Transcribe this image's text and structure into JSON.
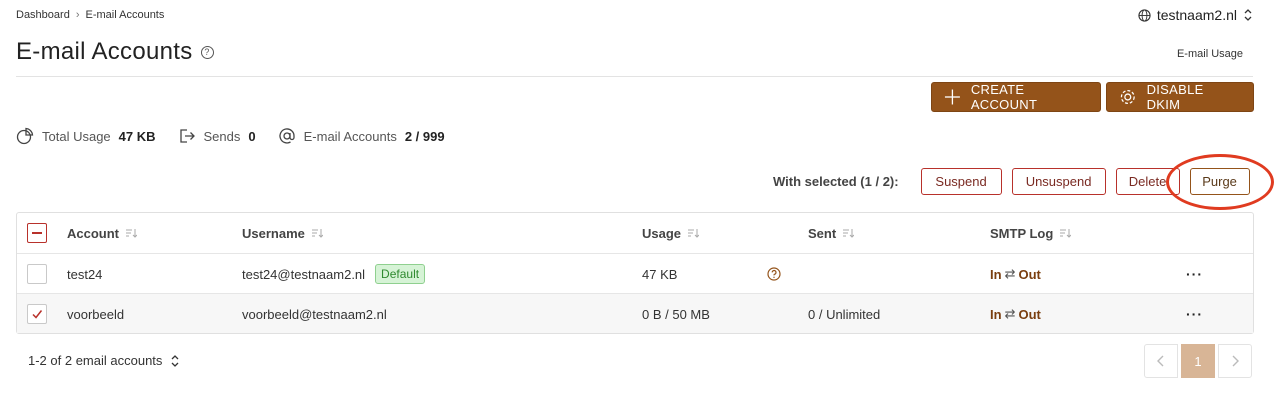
{
  "breadcrumb": {
    "home": "Dashboard",
    "sep": "›",
    "current": "E-mail Accounts"
  },
  "domain": {
    "value": "testnaam2.nl",
    "icon": "globe-icon"
  },
  "page": {
    "title": "E-mail Accounts",
    "help": "?",
    "usage_link": "E-mail Usage"
  },
  "actions": {
    "create": "CREATE ACCOUNT",
    "dkim": "DISABLE DKIM"
  },
  "stats": {
    "total_usage_label": "Total Usage",
    "total_usage_value": "47 KB",
    "sends_label": "Sends",
    "sends_value": "0",
    "accounts_label": "E-mail Accounts",
    "accounts_value": "2 / 999"
  },
  "bulk": {
    "label": "With selected (1 / 2):",
    "suspend": "Suspend",
    "unsuspend": "Unsuspend",
    "delete": "Delete",
    "purge": "Purge"
  },
  "table": {
    "headers": {
      "account": "Account",
      "username": "Username",
      "usage": "Usage",
      "sent": "Sent",
      "smtp": "SMTP Log"
    },
    "rows": [
      {
        "account": "test24",
        "username": "test24@testnaam2.nl",
        "badge": "Default",
        "usage": "47 KB",
        "sent": "",
        "smtp_in": "In",
        "smtp_arrow": "⇄",
        "smtp_out": "Out",
        "checked": false
      },
      {
        "account": "voorbeeld",
        "username": "voorbeeld@testnaam2.nl",
        "usage": "0 B / 50 MB",
        "sent": "0 / Unlimited",
        "smtp_in": "In",
        "smtp_arrow": "⇄",
        "smtp_out": "Out",
        "checked": true
      }
    ],
    "row_menu": "···"
  },
  "pagination": {
    "info": "1-2 of 2 email accounts",
    "current": "1"
  },
  "colors": {
    "accent": "#94531a",
    "danger": "#b8312b",
    "highlight": "#e03b20"
  }
}
